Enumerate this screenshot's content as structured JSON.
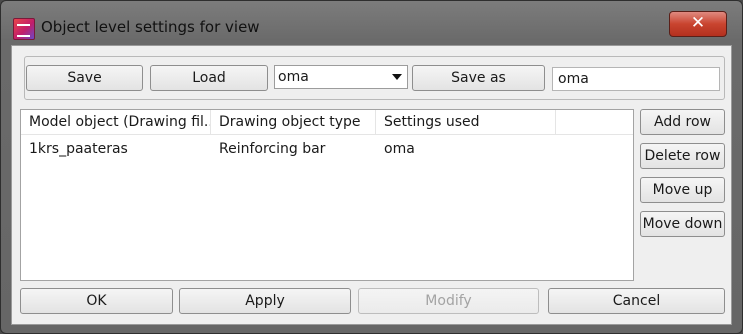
{
  "window": {
    "title": "Object level settings for view",
    "close_glyph": "✕"
  },
  "toolbar": {
    "save_label": "Save",
    "load_label": "Load",
    "settings_dropdown_value": "oma",
    "save_as_label": "Save as",
    "save_as_name_value": "oma"
  },
  "table": {
    "columns": [
      "Model object (Drawing fil...",
      "Drawing object type",
      "Settings used",
      ""
    ],
    "rows": [
      [
        "1krs_paateras",
        "Reinforcing bar",
        "oma"
      ]
    ]
  },
  "side_buttons": {
    "add_row": "Add row",
    "delete_row": "Delete row",
    "move_up": "Move up",
    "move_down": "Move down"
  },
  "footer": {
    "ok": "OK",
    "apply": "Apply",
    "modify": "Modify",
    "cancel": "Cancel"
  }
}
